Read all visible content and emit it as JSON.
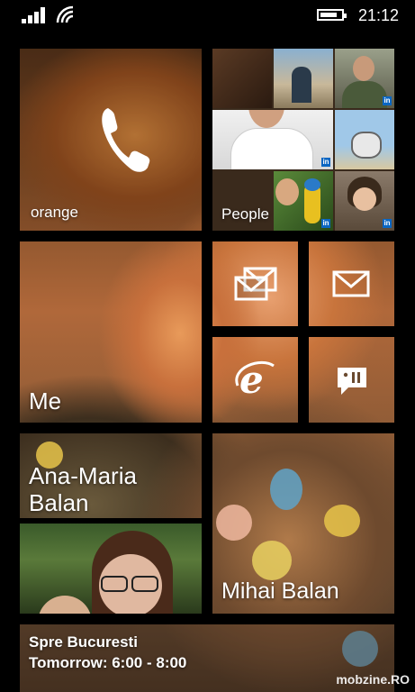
{
  "status_bar": {
    "time": "21:12"
  },
  "tiles": {
    "phone": {
      "label": "orange"
    },
    "people": {
      "label": "People"
    },
    "me": {
      "label": "Me"
    },
    "contact_ana": {
      "label_line1": "Ana-Maria",
      "label_line2": "Balan"
    },
    "contact_mihai": {
      "label": "Mihai Balan"
    },
    "calendar": {
      "line1": "Spre Bucuresti",
      "line2": "Tomorrow: 6:00 - 8:00"
    }
  },
  "watermark": "mobzine.RO",
  "icons": [
    "signal-icon",
    "wifi-icon",
    "battery-icon",
    "phone-icon",
    "messaging-icon",
    "mail-icon",
    "internet-explorer-icon",
    "feedback-icon",
    "linkedin-icon"
  ]
}
